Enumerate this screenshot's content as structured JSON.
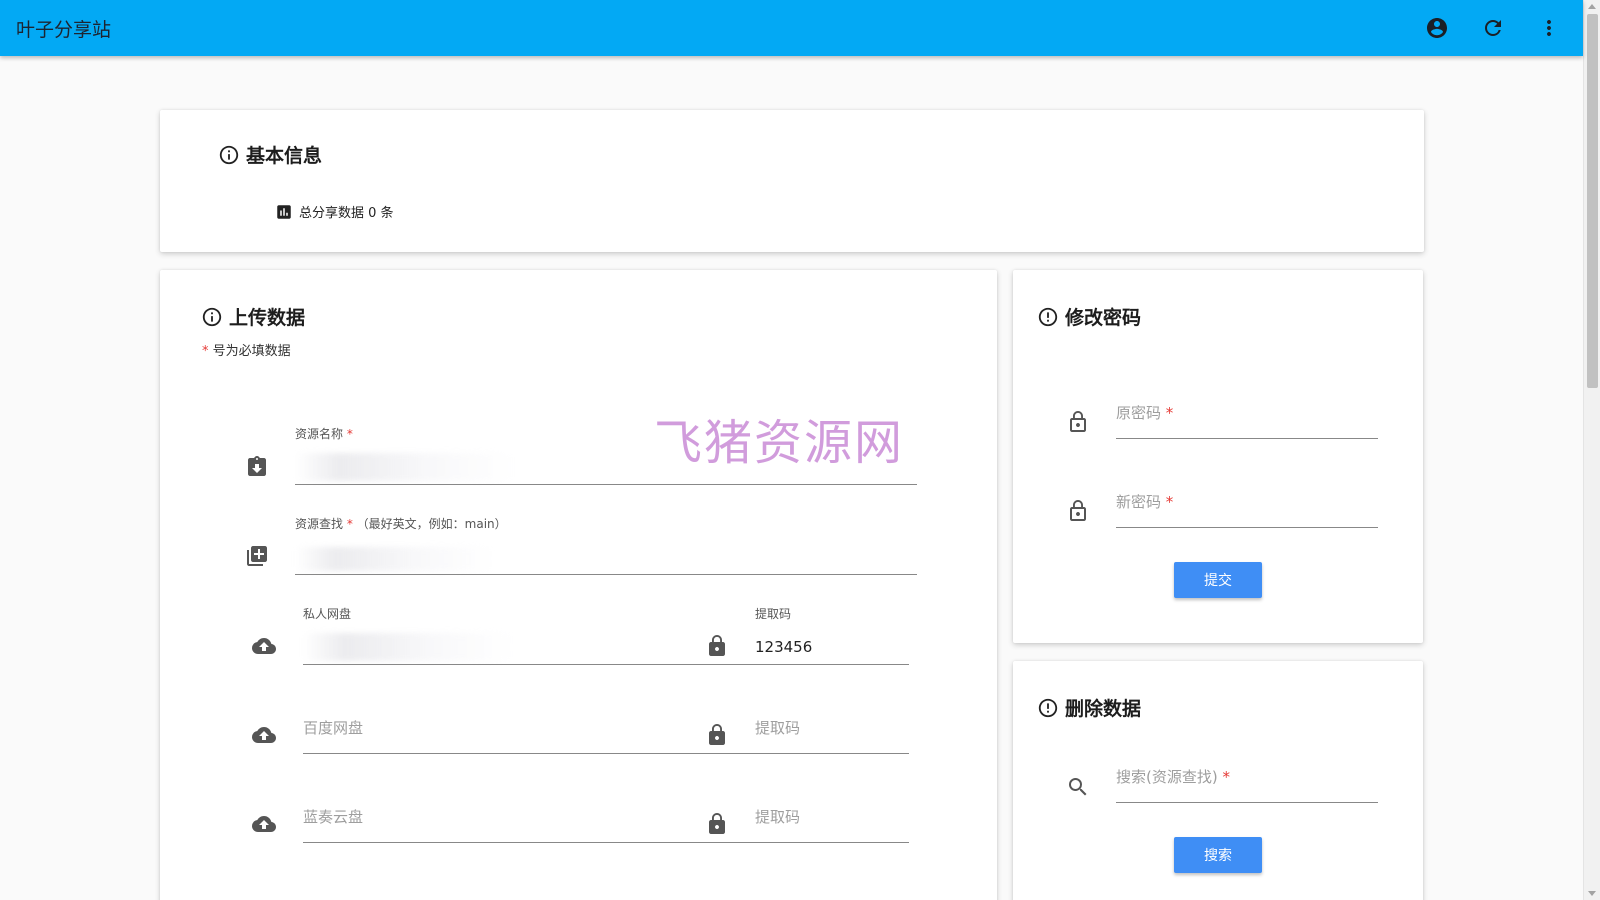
{
  "appbar": {
    "title": "叶子分享站",
    "actions": [
      {
        "icon": "account-circle-icon"
      },
      {
        "icon": "refresh-icon"
      },
      {
        "icon": "more-vert-icon"
      }
    ]
  },
  "basic_info": {
    "title": "基本信息",
    "stat_label": "总分享数据 0 条"
  },
  "upload": {
    "title": "上传数据",
    "note_star": "*",
    "note_text": " 号为必填数据",
    "resource_name": {
      "label": "资源名称",
      "star": "*",
      "value": ""
    },
    "resource_lookup": {
      "label": "资源查找",
      "star": "*",
      "hint": "（最好英文，例如：main）",
      "value": ""
    },
    "private_disk": {
      "label": "私人网盘",
      "value": ""
    },
    "private_code": {
      "label": "提取码",
      "value": "123456"
    },
    "baidu": {
      "placeholder": "百度网盘"
    },
    "baidu_code": {
      "placeholder": "提取码"
    },
    "lanzou": {
      "placeholder": "蓝奏云盘"
    },
    "lanzou_code": {
      "placeholder": "提取码"
    }
  },
  "change_password": {
    "title": "修改密码",
    "old_password": {
      "placeholder": "原密码",
      "star": "*"
    },
    "new_password": {
      "placeholder": "新密码",
      "star": "*"
    },
    "submit_label": "提交"
  },
  "delete_data": {
    "title": "删除数据",
    "search": {
      "placeholder": "搜索(资源查找)",
      "star": "*"
    },
    "search_label": "搜索"
  },
  "watermark": "飞猪资源网",
  "colors": {
    "appbar": "#03a9f4",
    "button": "#3f8ef5",
    "required": "#e53935"
  }
}
